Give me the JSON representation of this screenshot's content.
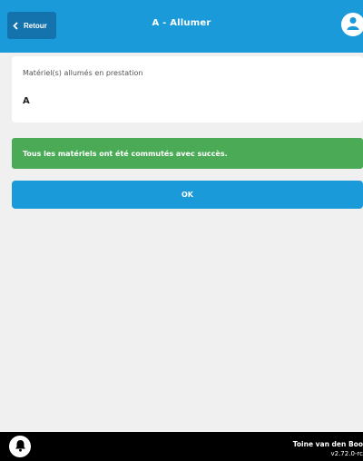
{
  "header": {
    "back_label": "Retour",
    "title": "A - Allumer",
    "back_icon": "chevron-left-icon",
    "user_icon": "user-icon"
  },
  "card": {
    "label": "Matériel(s) allumés en prestation",
    "value": "A"
  },
  "message": {
    "text": "Tous les matériels ont été commutés avec succès."
  },
  "actions": {
    "ok_label": "OK"
  },
  "footer": {
    "bell_icon": "bell-icon",
    "user_name": "Toine van den Boo",
    "version": "v2.72.0-rc"
  },
  "colors": {
    "primary": "#1a9ad9",
    "primary_dark": "#1473ad",
    "success": "#4aaa55",
    "background": "#f0f0f0",
    "footer": "#000000"
  }
}
